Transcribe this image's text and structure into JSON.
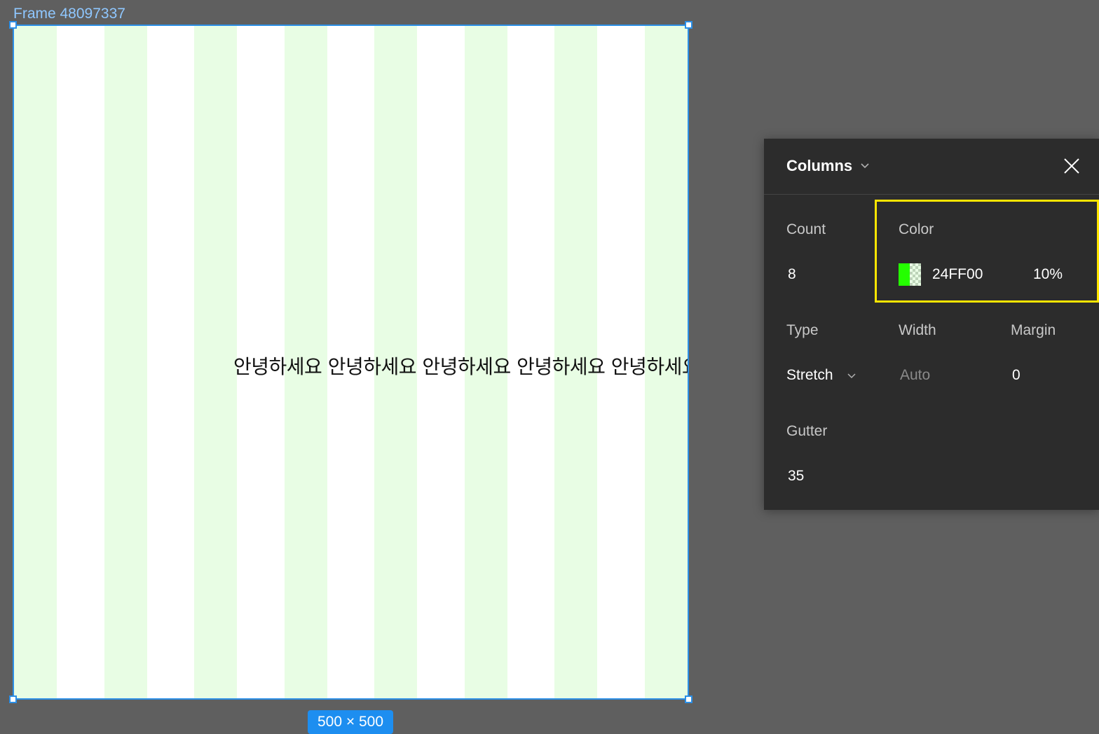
{
  "frame": {
    "name": "Frame 48097337",
    "text": "안녕하세요 안녕하세요 안녕하세요 안녕하세요 안녕하세요",
    "size_label": "500 × 500",
    "background_color": "#ffffff",
    "selection_color": "#2c8fe6"
  },
  "layout_grid": {
    "column_fill_color": "#e8fde4"
  },
  "panel": {
    "title": "Columns",
    "title_icon": "chevron-down-icon",
    "close_icon": "close-icon",
    "count": {
      "label": "Count",
      "value": "8"
    },
    "color": {
      "label": "Color",
      "hex": "24FF00",
      "swatch_color": "#24ff00",
      "opacity": "10%"
    },
    "type": {
      "label": "Type",
      "value": "Stretch",
      "icon": "chevron-down-icon"
    },
    "width": {
      "label": "Width",
      "value": "Auto"
    },
    "margin": {
      "label": "Margin",
      "value": "0"
    },
    "gutter": {
      "label": "Gutter",
      "value": "35"
    },
    "highlight_color": "#ffe600"
  }
}
